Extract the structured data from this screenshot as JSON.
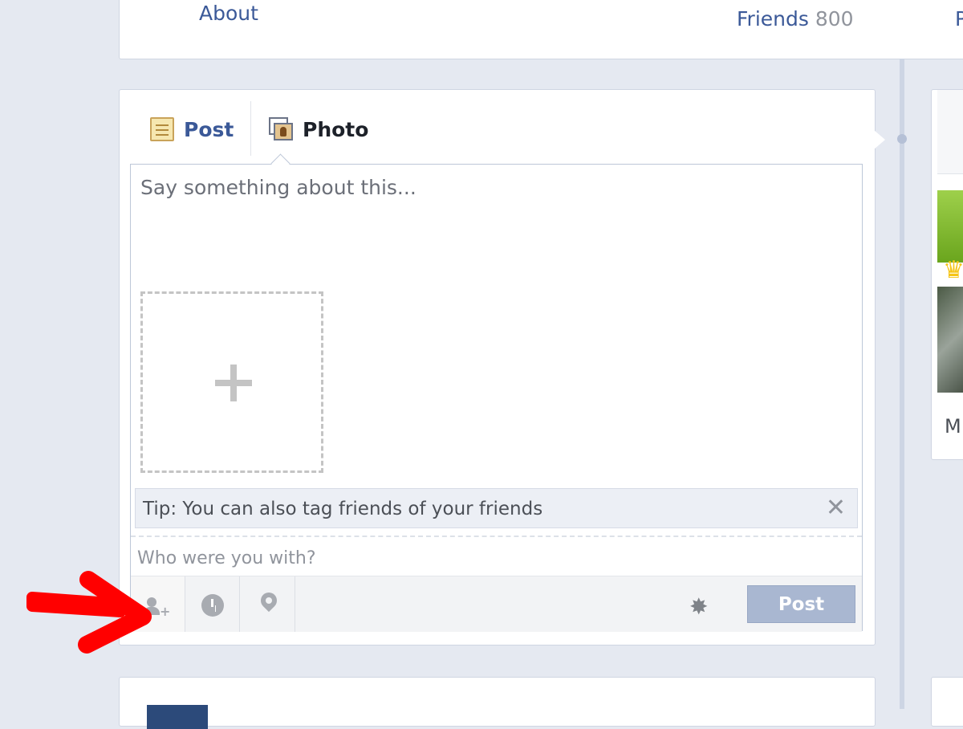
{
  "profile_nav": {
    "about_label": "About",
    "friends_label": "Friends",
    "friends_count": "800",
    "more_label": "P"
  },
  "composer": {
    "tabs": [
      {
        "label": "Post",
        "icon": "note-icon",
        "active": false
      },
      {
        "label": "Photo",
        "icon": "photo-icon",
        "active": true
      }
    ],
    "status_placeholder": "Say something about this...",
    "add_photo_icon": "plus-icon",
    "tip_text": "Tip: You can also tag friends of your friends",
    "tip_close": "✕",
    "with_placeholder": "Who were you with?",
    "toolbar": {
      "tag_icon": "tag-friends-icon",
      "time_icon": "clock-icon",
      "location_icon": "location-pin-icon",
      "privacy_icon": "gear-icon",
      "post_label": "Post"
    }
  },
  "right_card": {
    "partial_text": "M"
  },
  "annotation": {
    "arrow_color": "#ff0000"
  },
  "colors": {
    "link": "#3b5998",
    "post_button": "#a9b7d1",
    "page_bg": "#e5e9f1"
  }
}
